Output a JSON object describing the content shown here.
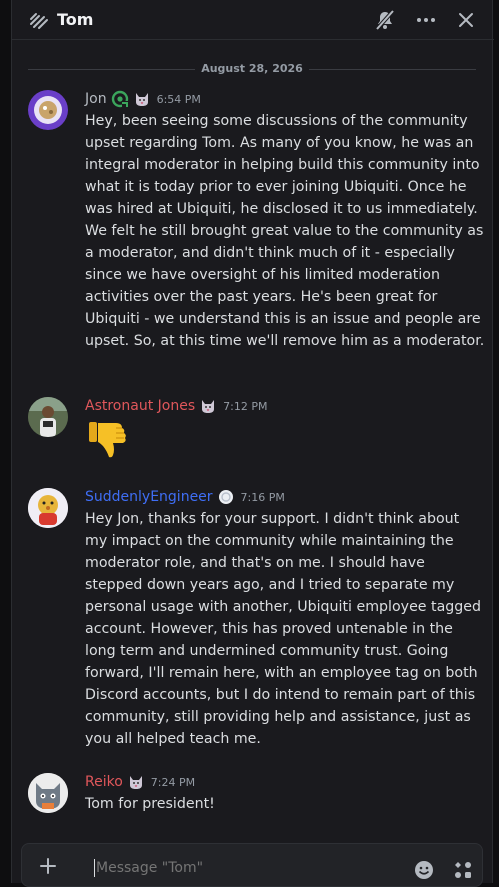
{
  "header": {
    "title": "Tom",
    "icons": {
      "thread": "thread-icon",
      "mute": "notification-bell-muted-icon",
      "more": "more-options-icon",
      "close": "close-icon"
    }
  },
  "date_divider": "August 28, 2026",
  "messages": [
    {
      "author": "Jon",
      "author_color": "#b5bac1",
      "badges": [
        "app-logo-badge-icon",
        "cat-badge-icon"
      ],
      "time": "6:54 PM",
      "text": "Hey, been seeing some discussions of the community upset regarding Tom. As many of you know, he was an integral moderator in helping build this community into what it is today prior to ever joining Ubiquiti. Once he was hired at Ubiquiti, he disclosed it to us immediately. We felt he still brought great value to the community as a moderator, and didn't think much of it - especially since we have oversight of his limited moderation activities over the past years. He's been great for Ubiquiti - we understand this is an issue and people are upset. So, at this time we'll remove him as a moderator."
    },
    {
      "author": "Astronaut Jones",
      "author_color": "#e0575b",
      "badges": [
        "cat-badge-icon"
      ],
      "time": "7:12 PM",
      "emoji": "thumbs-down-emoji"
    },
    {
      "author": "SuddenlyEngineer",
      "author_color": "#3f6ef5",
      "badges": [
        "orb-badge-icon"
      ],
      "time": "7:16 PM",
      "text": "Hey Jon, thanks for your support. I didn't think about my impact on the community while maintaining the moderator role, and that's on me. I should have stepped down years ago, and I tried to separate my personal usage with another, Ubiquiti employee tagged account. However, this has proved untenable in the long term and undermined community trust. Going forward, I'll remain here, with an employee tag on both Discord accounts, but I do intend to remain part of this community, still providing help and assistance, just as you all helped teach me."
    },
    {
      "author": "Reiko",
      "author_color": "#e0575b",
      "badges": [
        "cat-badge-icon"
      ],
      "time": "7:24 PM",
      "text": "Tom for president!"
    }
  ],
  "composer": {
    "placeholder": "Message \"Tom\"",
    "icons": {
      "add": "add-attachment-icon",
      "emoji": "emoji-icon",
      "apps": "apps-icon"
    }
  }
}
